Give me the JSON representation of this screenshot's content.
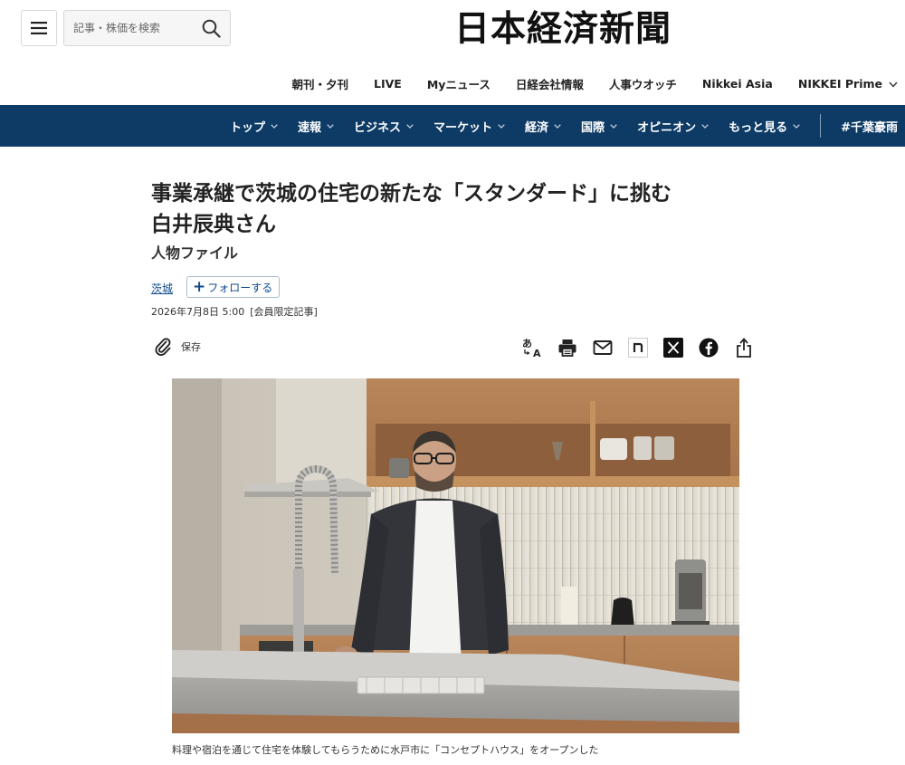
{
  "header": {
    "search_placeholder": "記事・株価を検索",
    "logo_text": "日本経済新聞"
  },
  "subnav": [
    {
      "label": "朝刊・夕刊"
    },
    {
      "label": "LIVE"
    },
    {
      "label": "Myニュース"
    },
    {
      "label": "日経会社情報"
    },
    {
      "label": "人事ウオッチ"
    },
    {
      "label": "Nikkei Asia"
    },
    {
      "label": "NIKKEI Prime"
    }
  ],
  "mainnav": {
    "items": [
      {
        "label": "トップ"
      },
      {
        "label": "速報"
      },
      {
        "label": "ビジネス"
      },
      {
        "label": "マーケット"
      },
      {
        "label": "経済"
      },
      {
        "label": "国際"
      },
      {
        "label": "オピニオン"
      },
      {
        "label": "もっと見る"
      }
    ],
    "tag": "#千葉豪雨"
  },
  "article": {
    "headline_line1": "事業承継で茨城の住宅の新たな「スタンダード」に挑む",
    "headline_line2": "白井辰典さん",
    "series": "人物ファイル",
    "topic": "茨城",
    "follow_label": "フォローする",
    "date": "2026年7月8日 5:00",
    "member_note": "[会員限定記事]",
    "save_label": "保存",
    "caption": "料理や宿泊を通じて住宅を体験してもらうために水戸市に「コンセプトハウス」をオープンした"
  },
  "colors": {
    "nav_bg": "#0d3b66",
    "link": "#0d4b8c"
  },
  "icons": {
    "menu": "menu-icon",
    "search": "search-icon",
    "save": "paperclip-icon",
    "share": [
      "translate-icon",
      "print-icon",
      "mail-icon",
      "note-icon",
      "x-icon",
      "facebook-icon",
      "share-icon"
    ]
  }
}
